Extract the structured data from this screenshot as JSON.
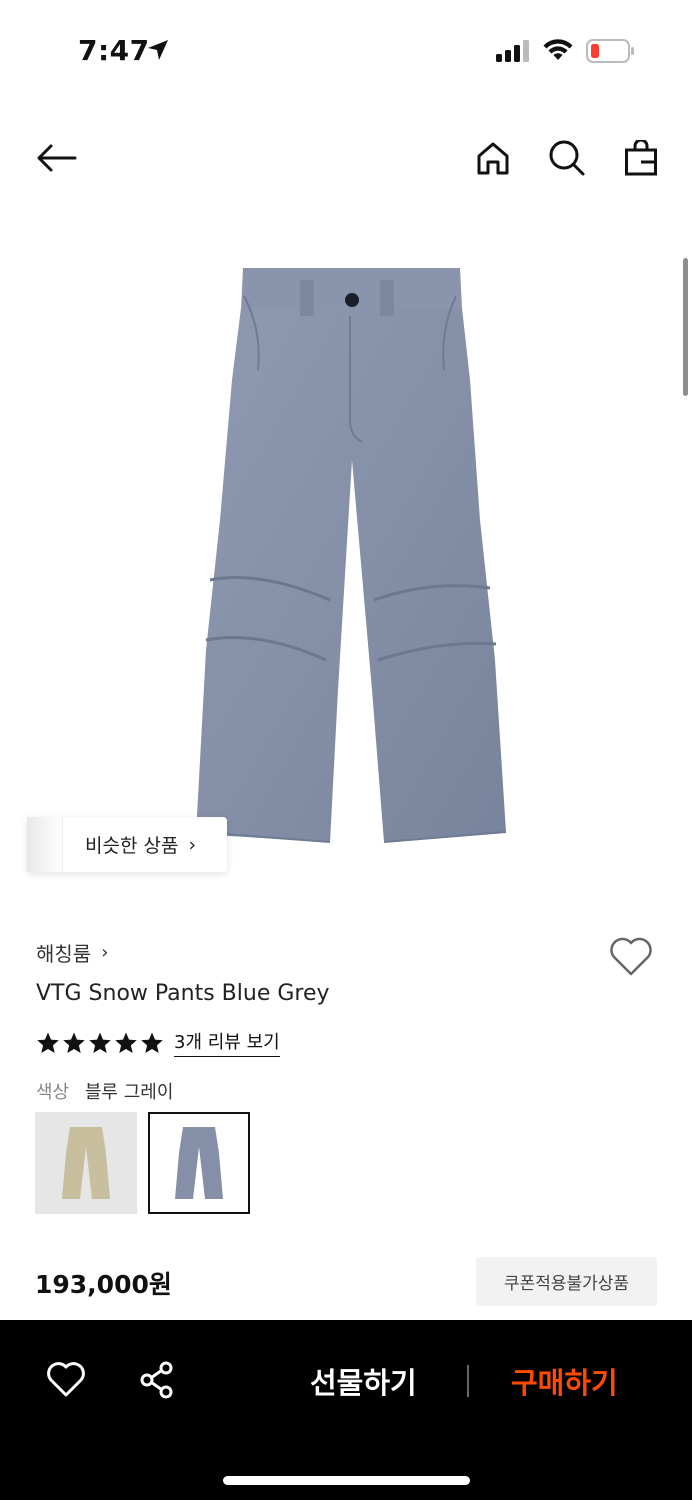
{
  "status_bar": {
    "time": "7:47",
    "battery_color": "#ff3b30"
  },
  "nav": {
    "back_icon": "arrow-left-icon",
    "home_icon": "home-icon",
    "search_icon": "search-icon",
    "bag_icon": "shopping-bag-icon"
  },
  "product": {
    "image_desc_icon": "pants-image",
    "similar_label": "비슷한 상품",
    "similar_chevron": "›",
    "brand": "해칭룸",
    "brand_chevron": "›",
    "title": "VTG Snow Pants Blue Grey",
    "rating": 5,
    "rating_max": 5,
    "review_link": "3개 리뷰 보기",
    "color_key": "색상",
    "color_value": "블루 그레이",
    "swatches": [
      {
        "name": "beige",
        "color": "#c8bf9f",
        "selected": false
      },
      {
        "name": "blue-grey",
        "color": "#8590a8",
        "selected": true
      }
    ],
    "price": "193,000원",
    "coupon_label": "쿠폰적용불가상품"
  },
  "bottom_bar": {
    "wishlist_icon": "heart-icon",
    "share_icon": "share-icon",
    "gift_label": "선물하기",
    "buy_label": "구매하기",
    "accent_color": "#ff4b00"
  }
}
